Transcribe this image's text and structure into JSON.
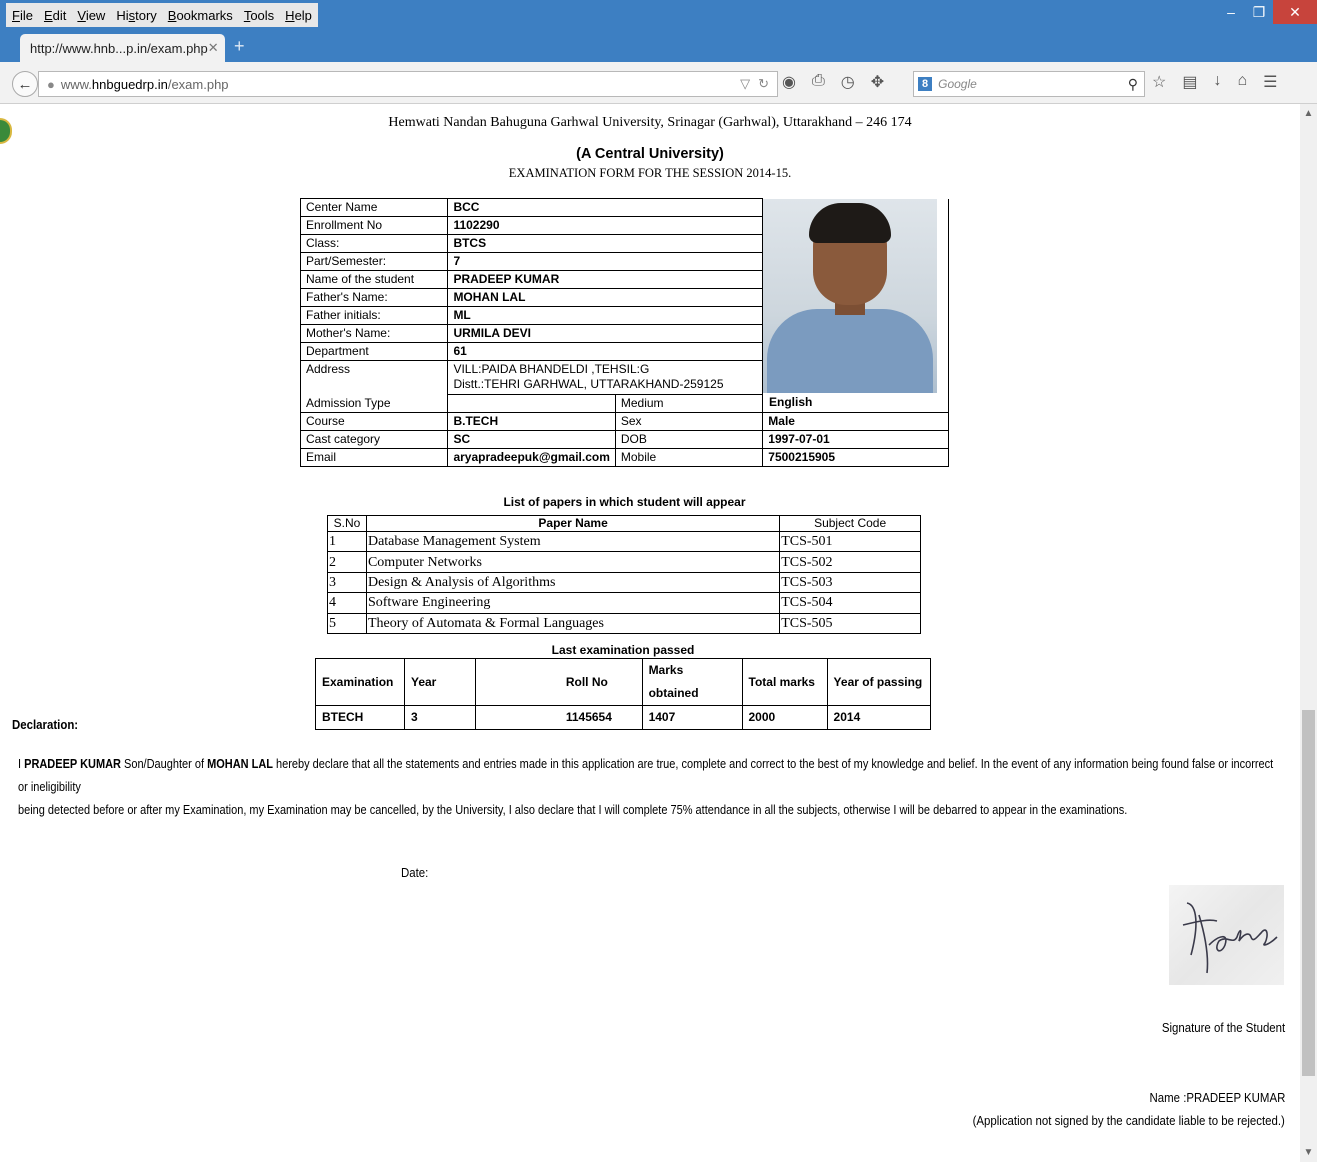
{
  "browser": {
    "menu": [
      "File",
      "Edit",
      "View",
      "History",
      "Bookmarks",
      "Tools",
      "Help"
    ],
    "menu_underline": [
      "F",
      "E",
      "V",
      "s",
      "B",
      "T",
      "H"
    ],
    "tab_title": "http://www.hnb...p.in/exam.php",
    "url_prefix": "www.",
    "url_host": "hnbguedrp.in",
    "url_path": "/exam.php",
    "search_placeholder": "Google",
    "search_engine_badge": "8"
  },
  "header": {
    "university": "Hemwati Nandan Bahuguna Garhwal University, Srinagar (Garhwal), Uttarakhand – 246 174",
    "subtitle": "(A Central University)",
    "form_title": "EXAMINATION  FORM FOR THE SESSION 2014-15."
  },
  "student": {
    "center_name_label": "Center Name",
    "center_name": "BCC",
    "enrollment_label": "Enrollment No",
    "enrollment": "1102290",
    "class_label": "Class:",
    "class": "BTCS",
    "part_label": "Part/Semester:",
    "part": "7",
    "name_label": "Name of the student",
    "name": "PRADEEP KUMAR",
    "father_label": "Father's Name:",
    "father": "MOHAN LAL",
    "father_initials_label": "Father initials:",
    "father_initials": "ML",
    "mother_label": "Mother's Name:",
    "mother": "URMILA DEVI",
    "department_label": "Department",
    "department": "61",
    "address_label": "Address",
    "address_line1": "VILL:PAIDA BHANDELDI ,TEHSIL:G",
    "address_line2": "Distt.:TEHRI GARHWAL, UTTARAKHAND-259125",
    "admission_type_label": "Admission Type",
    "admission_type": "",
    "medium_label": "Medium",
    "medium": "English",
    "course_label": "Course",
    "course": "B.TECH",
    "sex_label": "Sex",
    "sex": "Male",
    "category_label": "Cast category",
    "category": "SC",
    "dob_label": "DOB",
    "dob": "1997-07-01",
    "email_label": "Email",
    "email": "aryapradeepuk@gmail.com",
    "mobile_label": "Mobile",
    "mobile": "7500215905"
  },
  "papers": {
    "title": "List of papers in which student will appear",
    "headers": [
      "S.No",
      "Paper Name",
      "Subject Code"
    ],
    "rows": [
      [
        "1",
        "Database Management System",
        "TCS-501"
      ],
      [
        "2",
        "Computer Networks",
        "TCS-502"
      ],
      [
        "3",
        "Design & Analysis of Algorithms",
        "TCS-503"
      ],
      [
        "4",
        "Software Engineering",
        "TCS-504"
      ],
      [
        "5",
        "Theory of Automata & Formal Languages",
        "TCS-505"
      ]
    ]
  },
  "last_exam": {
    "title": "Last examination passed",
    "headers": [
      "Examination",
      "Year",
      "Roll No",
      "Marks obtained",
      "Total marks",
      "Year of passing"
    ],
    "row": [
      "BTECH",
      "3",
      "1145654",
      "1407",
      "2000",
      "2014"
    ]
  },
  "declaration": {
    "heading": "Declaration:",
    "p1": "I ",
    "student_name": "PRADEEP KUMAR",
    "p2": " Son/Daughter of ",
    "father_name": "MOHAN LAL",
    "p3": " hereby declare that all the statements and entries made in this application are true, complete and correct to the best of my knowledge and belief. In the event of any information being found false or incorrect or ineligibility",
    "p4": "being detected before or after my Examination, my Examination may be cancelled, by the University, I also declare that I will complete 75% attendance in all the subjects, otherwise I will be debarred to appear in the examinations."
  },
  "footer": {
    "date_label": "Date:",
    "signature_label": "Signature of the Student",
    "name_line": "Name :PRADEEP KUMAR",
    "note": "(Application not signed by the candidate liable to be rejected.)"
  },
  "colors": {
    "chrome_blue": "#3d7fc2",
    "close_red": "#c7443c"
  }
}
